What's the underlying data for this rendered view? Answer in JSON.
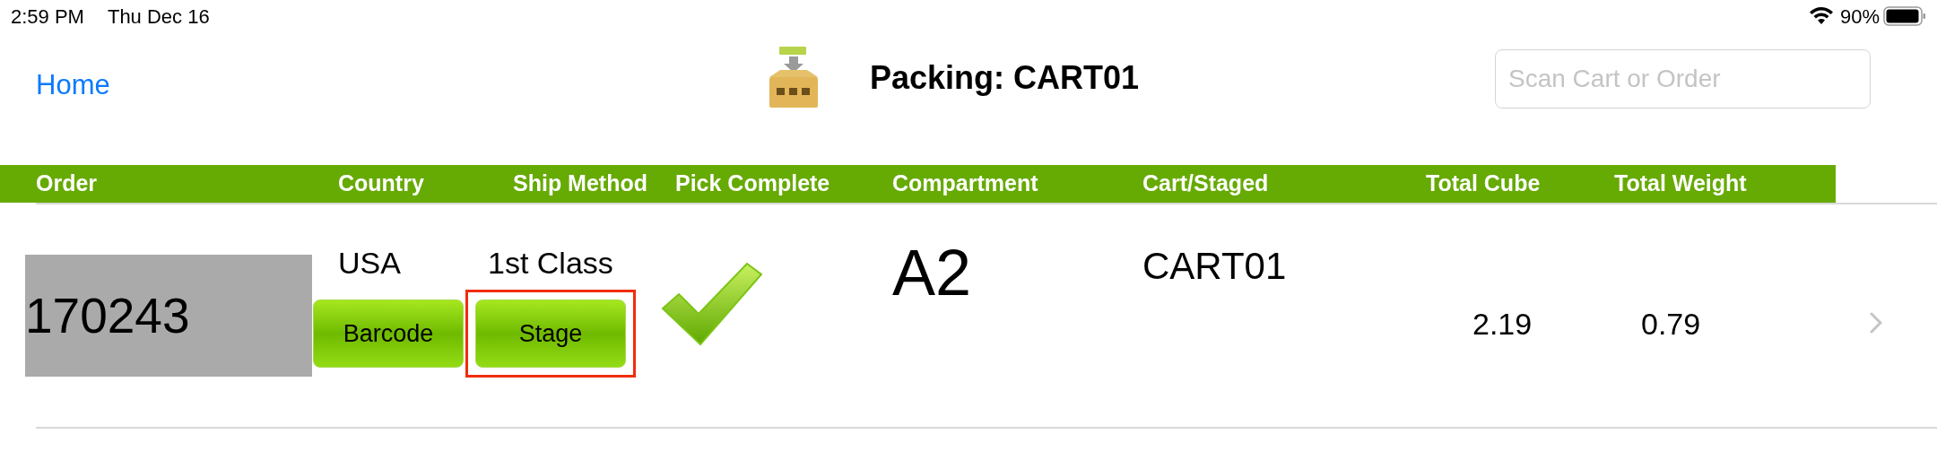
{
  "status_bar": {
    "time": "2:59 PM",
    "date": "Thu Dec 16",
    "battery": "90%"
  },
  "nav": {
    "back": "Home",
    "title": "Packing: CART01",
    "search": {
      "placeholder": "Scan Cart or Order"
    }
  },
  "table": {
    "columns": [
      "Order",
      "Country",
      "Ship Method",
      "Pick Complete",
      "Compartment",
      "Cart/Staged",
      "Total Cube",
      "Total Weight"
    ],
    "rows": [
      {
        "order": "170243",
        "country": "USA",
        "ship_method": "1st Class",
        "pick_complete": true,
        "compartment": "A2",
        "cart_staged": "CART01",
        "total_cube": "2.19",
        "total_weight": "0.79",
        "buttons": [
          {
            "label": "Barcode",
            "highlighted": false
          },
          {
            "label": "Stage",
            "highlighted": true
          }
        ]
      }
    ]
  }
}
